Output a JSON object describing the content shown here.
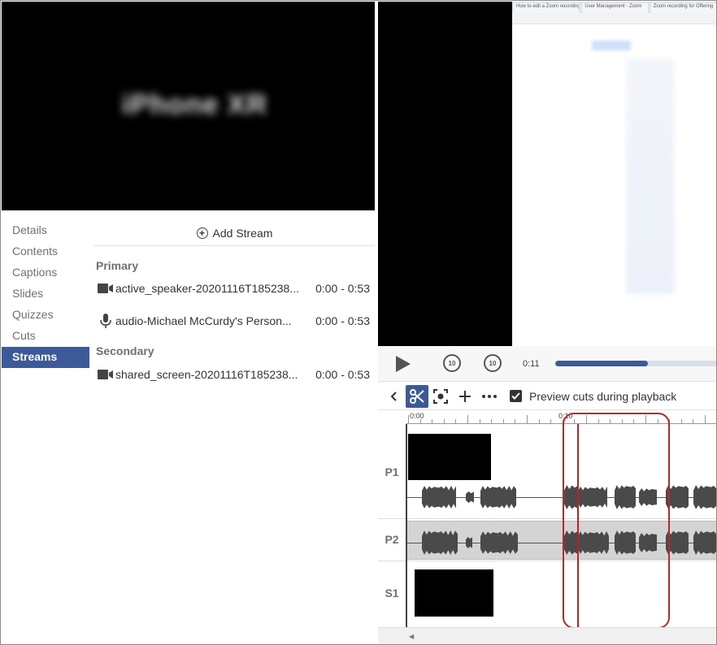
{
  "left_video": {
    "overlay_text": "iPhone XR"
  },
  "nav": {
    "items": [
      {
        "label": "Details"
      },
      {
        "label": "Contents"
      },
      {
        "label": "Captions"
      },
      {
        "label": "Slides"
      },
      {
        "label": "Quizzes"
      },
      {
        "label": "Cuts"
      },
      {
        "label": "Streams",
        "active": true
      }
    ]
  },
  "streams_panel": {
    "add_stream_label": "Add Stream",
    "primary": {
      "title": "Primary",
      "items": [
        {
          "icon": "video-camera-icon",
          "name": "active_speaker-20201116T185238...",
          "time": "0:00 - 0:53"
        },
        {
          "icon": "microphone-icon",
          "name": "audio-Michael McCurdy's Person...",
          "time": "0:00 - 0:53"
        }
      ]
    },
    "secondary": {
      "title": "Secondary",
      "items": [
        {
          "icon": "video-camera-icon",
          "name": "shared_screen-20201116T185238...",
          "time": "0:00 - 0:53"
        }
      ]
    }
  },
  "shared_screen": {
    "tabs": [
      "How to edit a Zoom recording",
      "User Management - Zoom",
      "Zoom recording for Offering"
    ]
  },
  "player": {
    "current_time": "0:11",
    "progress": 0.57,
    "skip_back": "10",
    "skip_forward": "10"
  },
  "toolbar": {
    "preview_label": "Preview cuts during playback",
    "preview_checked": true
  },
  "timeline": {
    "ruler_labels": [
      "0:00",
      "0:10"
    ],
    "tracks": [
      {
        "label": "P1"
      },
      {
        "label": "P2"
      },
      {
        "label": "S1"
      }
    ]
  },
  "colors": {
    "accent": "#3c5a9a",
    "cut_highlight": "#b32a2a"
  }
}
